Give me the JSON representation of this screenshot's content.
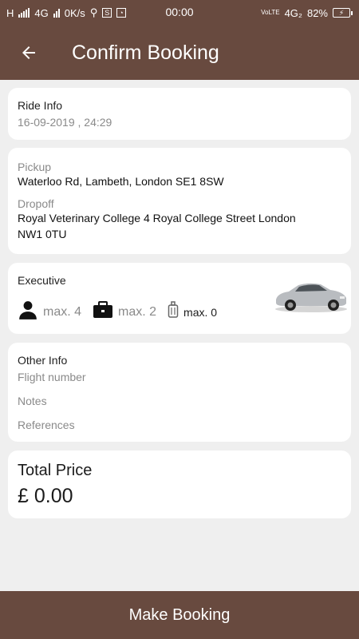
{
  "status": {
    "carrier": "H",
    "network": "4G",
    "speed": "0K/s",
    "time": "00:00",
    "volte": "VoLTE",
    "network_right": "4G₂",
    "battery": "82%"
  },
  "header": {
    "title": "Confirm Booking"
  },
  "ride_info": {
    "label": "Ride Info",
    "datetime": "16-09-2019 , 24:29"
  },
  "address": {
    "pickup_label": "Pickup",
    "pickup_value": "Waterloo Rd, Lambeth, London SE1 8SW",
    "dropoff_label": "Dropoff",
    "dropoff_value_line1": "Royal Veterinary College  4 Royal College Street  London",
    "dropoff_value_line2": "NW1 0TU"
  },
  "vehicle": {
    "class": "Executive",
    "passengers": "max. 4",
    "suitcases": "max. 2",
    "luggage": "max. 0",
    "icons": [
      "person-icon",
      "briefcase-icon",
      "luggage-icon"
    ]
  },
  "other_info": {
    "label": "Other Info",
    "flight_placeholder": "Flight number",
    "notes_placeholder": "Notes",
    "references_placeholder": "References"
  },
  "price": {
    "label": "Total Price",
    "value": "£ 0.00"
  },
  "footer": {
    "button_label": "Make Booking"
  },
  "colors": {
    "primary": "#684a3f",
    "background": "#efefef",
    "card": "#ffffff",
    "muted_text": "#8a8a8a"
  }
}
